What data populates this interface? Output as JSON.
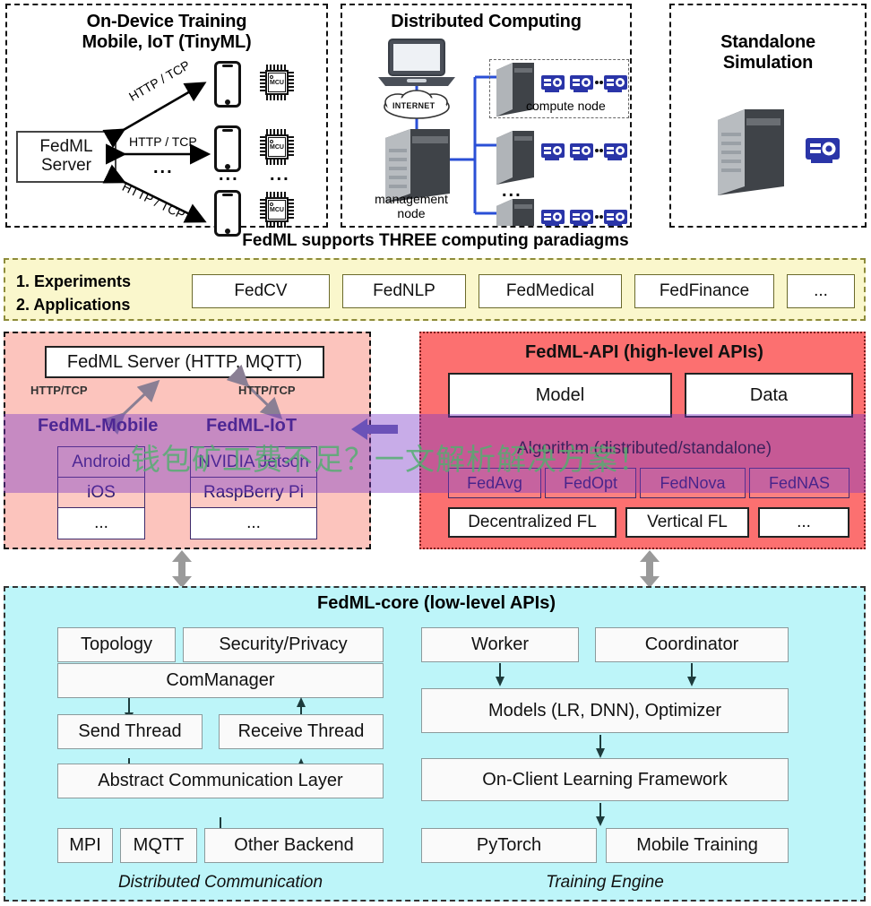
{
  "paradigms": {
    "caption": "FedML supports THREE computing paradiagms",
    "ondevice": {
      "title_line1": "On-Device Training",
      "title_line2": "Mobile, IoT (TinyML)",
      "server_label": "FedML\nServer",
      "server_label_l1": "FedML",
      "server_label_l2": "Server",
      "link_top": "HTTP / TCP",
      "link_mid": "HTTP / TCP",
      "link_bottom": "HTTP / TCP",
      "mcu_label": "MCU",
      "ellipsis": "..."
    },
    "distributed": {
      "title": "Distributed Computing",
      "internet_label": "INTERNET",
      "compute_node_label": "compute node",
      "management_node_l1": "management",
      "management_node_l2": "node",
      "ellipsis": "..."
    },
    "standalone": {
      "title_line1": "Standalone",
      "title_line2": "Simulation"
    }
  },
  "experiments": {
    "lead_line1": "1. Experiments",
    "lead_line2": "2. Applications",
    "apps": [
      "FedCV",
      "FedNLP",
      "FedMedical",
      "FedFinance",
      "..."
    ]
  },
  "mid_left": {
    "server_box": "FedML Server (HTTP, MQTT)",
    "link_left": "HTTP/TCP",
    "link_right": "HTTP/TCP",
    "mobile_title": "FedML-Mobile",
    "iot_title": "FedML-IoT",
    "mobile_items": [
      "Android",
      "iOS",
      "..."
    ],
    "iot_items": [
      "NVIDIA Jetson",
      "RaspBerry Pi",
      "..."
    ]
  },
  "mid_right": {
    "title": "FedML-API (high-level APIs)",
    "model_box": "Model",
    "data_box": "Data",
    "algorithm_title": "Algorithm (distributed/standalone)",
    "algorithms": [
      "FedAvg",
      "FedOpt",
      "FedNova",
      "FedNAS"
    ],
    "fl_boxes": [
      "Decentralized FL",
      "Vertical FL",
      "..."
    ]
  },
  "core": {
    "title": "FedML-core (low-level APIs)",
    "left_caption": "Distributed Communication",
    "right_caption": "Training Engine",
    "topology": "Topology",
    "security": "Security/Privacy",
    "commanager": "ComManager",
    "send_thread": "Send Thread",
    "receive_thread": "Receive Thread",
    "abstract_layer": "Abstract Communication Layer",
    "mpi": "MPI",
    "mqtt": "MQTT",
    "other_backend": "Other Backend",
    "worker": "Worker",
    "coordinator": "Coordinator",
    "models": "Models (LR, DNN), Optimizer",
    "onclient": "On-Client Learning Framework",
    "pytorch": "PyTorch",
    "mobile_training": "Mobile Training"
  },
  "watermark": {
    "text": "钱包矿工费不足？一文解析解决方案！",
    "color": "#50af6e"
  },
  "colors": {
    "band_yellow": "#faf7cc",
    "mid_left_pink": "#fcc4bd",
    "mid_right_red": "#fc7070",
    "core_cyan": "#bdf5f9",
    "purple_band": "#7c3ac8",
    "gpu_blue": "#2a35a8"
  }
}
